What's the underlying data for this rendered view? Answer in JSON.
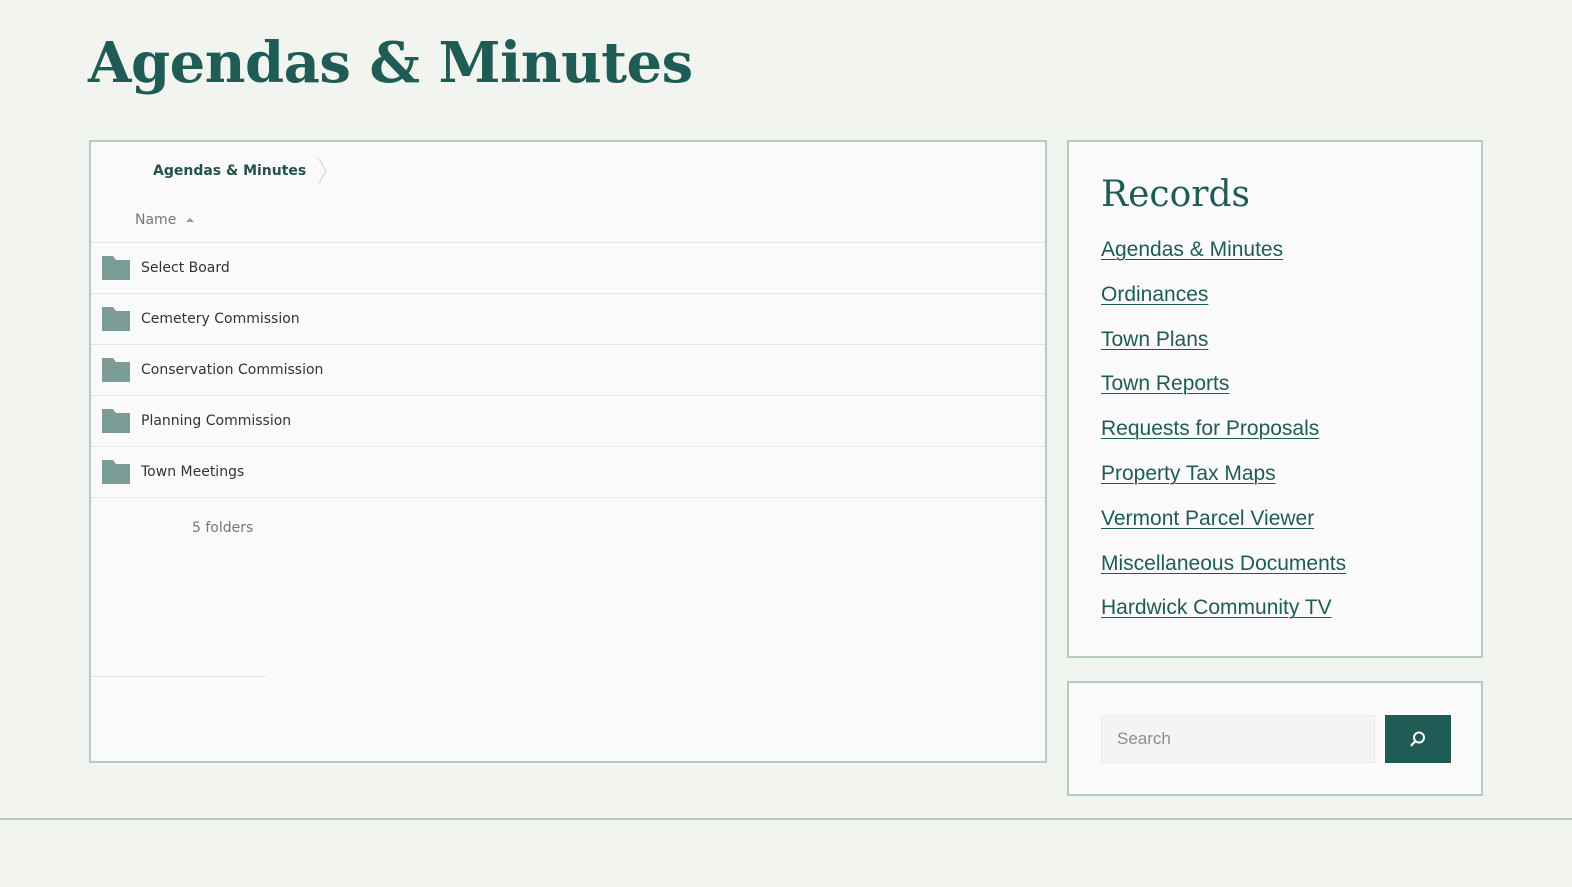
{
  "page": {
    "title": "Agendas & Minutes"
  },
  "file_browser": {
    "breadcrumb": [
      "Agendas & Minutes"
    ],
    "column_header": "Name",
    "sort": "ascending",
    "folders": [
      {
        "name": "Select Board"
      },
      {
        "name": "Cemetery Commission"
      },
      {
        "name": "Conservation Commission"
      },
      {
        "name": "Planning Commission"
      },
      {
        "name": "Town Meetings"
      }
    ],
    "summary": "5 folders"
  },
  "records": {
    "title": "Records",
    "links": [
      "Agendas & Minutes",
      "Ordinances",
      "Town Plans",
      "Town Reports",
      "Requests for Proposals",
      "Property Tax Maps",
      "Vermont Parcel Viewer",
      "Miscellaneous Documents",
      "Hardwick Community TV"
    ]
  },
  "search": {
    "placeholder": "Search",
    "button_icon": "search-icon"
  },
  "colors": {
    "brand": "#1f5c55",
    "page_background": "#f2f5ef",
    "panel_border": "#b7c9c5",
    "folder_icon": "#7c9c98"
  }
}
